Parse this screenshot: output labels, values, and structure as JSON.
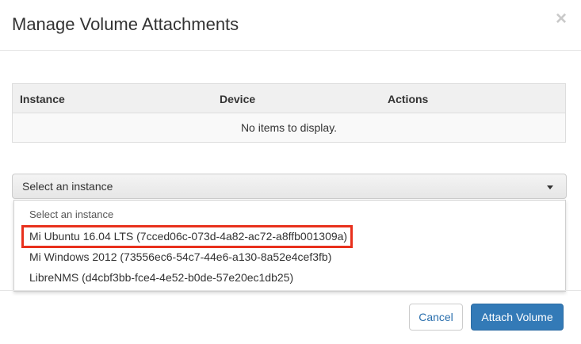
{
  "dialog": {
    "title": "Manage Volume Attachments",
    "close_symbol": "×"
  },
  "table": {
    "columns": [
      "Instance",
      "Device",
      "Actions"
    ],
    "empty_message": "No items to display."
  },
  "instance_select": {
    "selected": "Select an instance",
    "options": [
      "Select an instance",
      "Mi Ubuntu 16.04 LTS (7cced06c-073d-4a82-ac72-a8ffb001309a)",
      "Mi Windows 2012 (73556ec6-54c7-44e6-a130-8a52e4cef3fb)",
      "LibreNMS (d4cbf3bb-fce4-4e52-b0de-57e20ec1db25)"
    ],
    "highlighted_option_index": 1
  },
  "footer": {
    "cancel_label": "Cancel",
    "attach_label": "Attach Volume"
  },
  "colors": {
    "primary": "#337ab7",
    "highlight": "#e8301c",
    "link": "#2a6fad"
  }
}
